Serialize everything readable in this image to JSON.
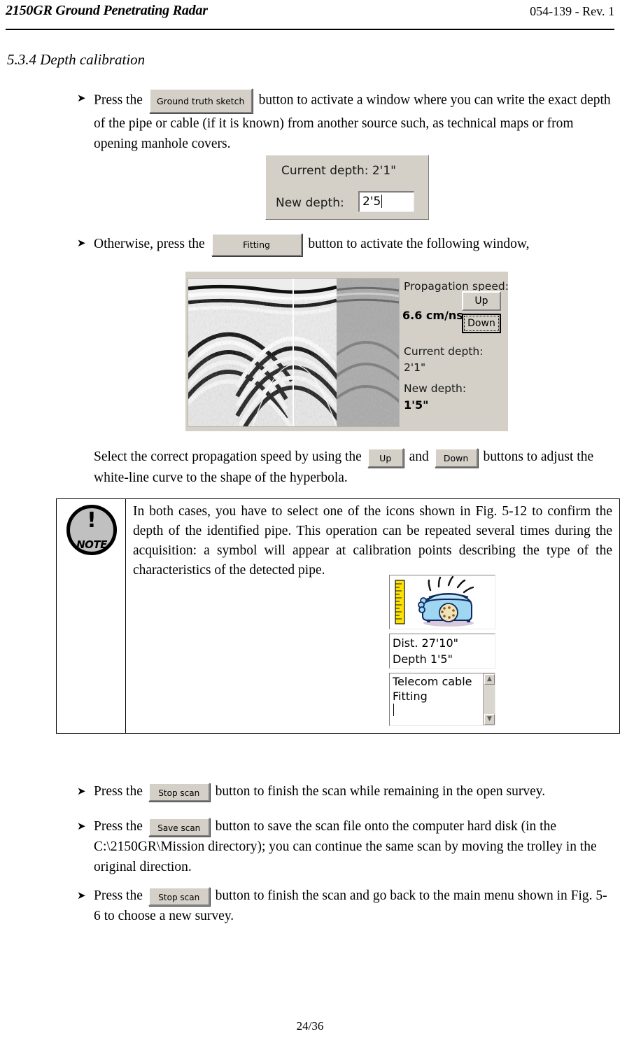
{
  "header": {
    "title": "2150GR Ground Penetrating Radar",
    "doc_ref": "054-139 - Rev. 1"
  },
  "section": {
    "heading": "5.3.4 Depth calibration"
  },
  "bullets": {
    "marker": "➤",
    "b1": {
      "text_before": "Press the",
      "button_label": "Ground truth sketch",
      "text_after": "button to activate a window where you can write the exact depth of the pipe or cable (if it is known) from another source such, as technical maps or from opening manhole covers."
    },
    "b2": {
      "text_before": "Otherwise, press the",
      "button_label": "Fitting",
      "text_after": "button to activate the following window,"
    },
    "b3": {
      "text_before": "Select the correct propagation speed by using the",
      "up_label": "Up",
      "text_middle": "and",
      "down_label": "Down",
      "text_after": "buttons to adjust the white-line curve to the shape of the hyperbola."
    },
    "b4": {
      "text_before": "Press the",
      "button_label": "Stop scan",
      "text_after": "button to finish the scan while remaining in the open survey."
    },
    "b5": {
      "text_before": "Press the",
      "button_label": "Save scan",
      "text_after": "button to save the scan file onto the computer hard disk (in the C:\\2150GR\\Mission directory); you can continue the same scan by moving the trolley in the original direction."
    },
    "b6": {
      "text_before": "Press the",
      "button_label": "Stop scan",
      "text_after": "button to finish the scan and go back to the main menu shown in Fig. 5-6 to choose a new survey."
    }
  },
  "depth_dialog": {
    "current_depth_line": "Current depth: 2'1\"",
    "new_depth_label": "New depth:",
    "new_depth_value": "2'5"
  },
  "fitting_window": {
    "propagation_speed_label": "Propagation speed:",
    "propagation_speed_value": "6.6 cm/ns",
    "up_label": "Up",
    "down_label": "Down",
    "current_depth_label": "Current depth:",
    "current_depth_value": "2'1\"",
    "new_depth_label": "New depth:",
    "new_depth_value": "1'5\""
  },
  "note": {
    "icon_bang": "!",
    "icon_word": "NOTE",
    "text": "In both cases, you have to select one of the icons shown in Fig. 5-12 to confirm the depth of the identified pipe. This operation can be repeated several times during the acquisition: a symbol will appear at calibration points describing the type of the characteristics of the detected pipe."
  },
  "icon_panel": {
    "dist_line": "Dist. 27'10\"",
    "depth_line": "Depth 1'5\"",
    "list_item_1": "Telecom cable",
    "list_item_2": "Fitting",
    "scroll_up_glyph": "▲",
    "scroll_down_glyph": "▼"
  },
  "footer": {
    "page_number": "24/36"
  }
}
